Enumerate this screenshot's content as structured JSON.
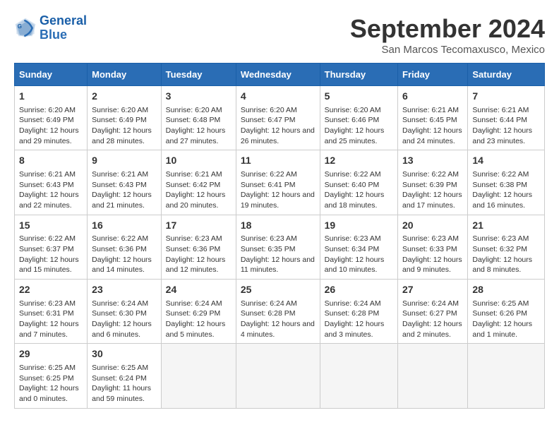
{
  "logo": {
    "line1": "General",
    "line2": "Blue"
  },
  "title": "September 2024",
  "location": "San Marcos Tecomaxusco, Mexico",
  "headers": [
    "Sunday",
    "Monday",
    "Tuesday",
    "Wednesday",
    "Thursday",
    "Friday",
    "Saturday"
  ],
  "weeks": [
    [
      {
        "day": "1",
        "rise": "6:20 AM",
        "set": "6:49 PM",
        "daylight": "12 hours and 29 minutes."
      },
      {
        "day": "2",
        "rise": "6:20 AM",
        "set": "6:49 PM",
        "daylight": "12 hours and 28 minutes."
      },
      {
        "day": "3",
        "rise": "6:20 AM",
        "set": "6:48 PM",
        "daylight": "12 hours and 27 minutes."
      },
      {
        "day": "4",
        "rise": "6:20 AM",
        "set": "6:47 PM",
        "daylight": "12 hours and 26 minutes."
      },
      {
        "day": "5",
        "rise": "6:20 AM",
        "set": "6:46 PM",
        "daylight": "12 hours and 25 minutes."
      },
      {
        "day": "6",
        "rise": "6:21 AM",
        "set": "6:45 PM",
        "daylight": "12 hours and 24 minutes."
      },
      {
        "day": "7",
        "rise": "6:21 AM",
        "set": "6:44 PM",
        "daylight": "12 hours and 23 minutes."
      }
    ],
    [
      {
        "day": "8",
        "rise": "6:21 AM",
        "set": "6:43 PM",
        "daylight": "12 hours and 22 minutes."
      },
      {
        "day": "9",
        "rise": "6:21 AM",
        "set": "6:43 PM",
        "daylight": "12 hours and 21 minutes."
      },
      {
        "day": "10",
        "rise": "6:21 AM",
        "set": "6:42 PM",
        "daylight": "12 hours and 20 minutes."
      },
      {
        "day": "11",
        "rise": "6:22 AM",
        "set": "6:41 PM",
        "daylight": "12 hours and 19 minutes."
      },
      {
        "day": "12",
        "rise": "6:22 AM",
        "set": "6:40 PM",
        "daylight": "12 hours and 18 minutes."
      },
      {
        "day": "13",
        "rise": "6:22 AM",
        "set": "6:39 PM",
        "daylight": "12 hours and 17 minutes."
      },
      {
        "day": "14",
        "rise": "6:22 AM",
        "set": "6:38 PM",
        "daylight": "12 hours and 16 minutes."
      }
    ],
    [
      {
        "day": "15",
        "rise": "6:22 AM",
        "set": "6:37 PM",
        "daylight": "12 hours and 15 minutes."
      },
      {
        "day": "16",
        "rise": "6:22 AM",
        "set": "6:36 PM",
        "daylight": "12 hours and 14 minutes."
      },
      {
        "day": "17",
        "rise": "6:23 AM",
        "set": "6:36 PM",
        "daylight": "12 hours and 12 minutes."
      },
      {
        "day": "18",
        "rise": "6:23 AM",
        "set": "6:35 PM",
        "daylight": "12 hours and 11 minutes."
      },
      {
        "day": "19",
        "rise": "6:23 AM",
        "set": "6:34 PM",
        "daylight": "12 hours and 10 minutes."
      },
      {
        "day": "20",
        "rise": "6:23 AM",
        "set": "6:33 PM",
        "daylight": "12 hours and 9 minutes."
      },
      {
        "day": "21",
        "rise": "6:23 AM",
        "set": "6:32 PM",
        "daylight": "12 hours and 8 minutes."
      }
    ],
    [
      {
        "day": "22",
        "rise": "6:23 AM",
        "set": "6:31 PM",
        "daylight": "12 hours and 7 minutes."
      },
      {
        "day": "23",
        "rise": "6:24 AM",
        "set": "6:30 PM",
        "daylight": "12 hours and 6 minutes."
      },
      {
        "day": "24",
        "rise": "6:24 AM",
        "set": "6:29 PM",
        "daylight": "12 hours and 5 minutes."
      },
      {
        "day": "25",
        "rise": "6:24 AM",
        "set": "6:28 PM",
        "daylight": "12 hours and 4 minutes."
      },
      {
        "day": "26",
        "rise": "6:24 AM",
        "set": "6:28 PM",
        "daylight": "12 hours and 3 minutes."
      },
      {
        "day": "27",
        "rise": "6:24 AM",
        "set": "6:27 PM",
        "daylight": "12 hours and 2 minutes."
      },
      {
        "day": "28",
        "rise": "6:25 AM",
        "set": "6:26 PM",
        "daylight": "12 hours and 1 minute."
      }
    ],
    [
      {
        "day": "29",
        "rise": "6:25 AM",
        "set": "6:25 PM",
        "daylight": "12 hours and 0 minutes."
      },
      {
        "day": "30",
        "rise": "6:25 AM",
        "set": "6:24 PM",
        "daylight": "11 hours and 59 minutes."
      },
      null,
      null,
      null,
      null,
      null
    ]
  ]
}
